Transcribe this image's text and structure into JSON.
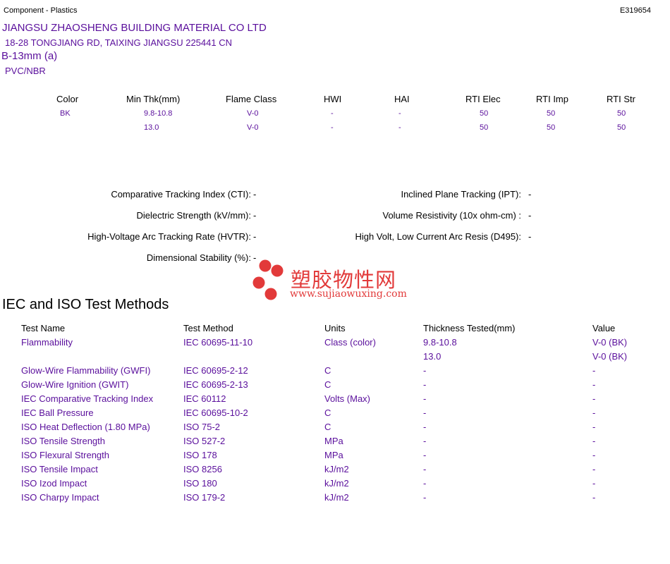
{
  "header": {
    "category": "Component - Plastics",
    "file_number": "E319654"
  },
  "company": {
    "name": "JIANGSU ZHAOSHENG BUILDING MATERIAL CO LTD",
    "address": "18-28 TONGJIANG RD, TAIXING  JIANGSU  225441 CN",
    "product": "B-13mm (a)",
    "material": "PVC/NBR"
  },
  "ratings_table": {
    "headers": [
      "Color",
      "Min Thk(mm)",
      "Flame Class",
      "HWI",
      "HAI",
      "RTI Elec",
      "RTI Imp",
      "RTI Str"
    ],
    "rows": [
      [
        "BK",
        "9.8-10.8",
        "V-0",
        "-",
        "-",
        "50",
        "50",
        "50"
      ],
      [
        "",
        "13.0",
        "V-0",
        "-",
        "-",
        "50",
        "50",
        "50"
      ]
    ]
  },
  "properties": {
    "left": [
      {
        "label": "Comparative Tracking Index (CTI):",
        "value": "-"
      },
      {
        "label": "Dielectric Strength (kV/mm):",
        "value": "-"
      },
      {
        "label": "High-Voltage Arc Tracking Rate (HVTR):",
        "value": "-"
      },
      {
        "label": "Dimensional Stability (%):",
        "value": "-"
      }
    ],
    "right": [
      {
        "label": "Inclined Plane Tracking (IPT):",
        "value": "-"
      },
      {
        "label": "Volume Resistivity (10x ohm-cm) :",
        "value": "-"
      },
      {
        "label": "High Volt, Low Current Arc Resis (D495):",
        "value": "-"
      }
    ]
  },
  "watermark": {
    "text": "塑胶物性网",
    "url": "www.sujiaowuxing.com",
    "color": "#e23a3a"
  },
  "test_methods": {
    "title": "IEC and ISO Test Methods",
    "headers": [
      "Test Name",
      "Test Method",
      "Units",
      "Thickness Tested(mm)",
      "Value"
    ],
    "rows": [
      [
        "Flammability",
        "IEC 60695-11-10",
        "Class (color)",
        "9.8-10.8",
        "V-0 (BK)"
      ],
      [
        "",
        "",
        "",
        "13.0",
        "V-0 (BK)"
      ],
      [
        "Glow-Wire Flammability (GWFI)",
        "IEC 60695-2-12",
        "C",
        "-",
        "-"
      ],
      [
        "Glow-Wire Ignition (GWIT)",
        "IEC 60695-2-13",
        "C",
        "-",
        "-"
      ],
      [
        "IEC Comparative Tracking Index",
        "IEC 60112",
        "Volts (Max)",
        "-",
        "-"
      ],
      [
        "IEC Ball Pressure",
        "IEC 60695-10-2",
        "C",
        "-",
        "-"
      ],
      [
        "ISO Heat Deflection (1.80 MPa)",
        "ISO 75-2",
        "C",
        "-",
        "-"
      ],
      [
        "ISO Tensile Strength",
        "ISO 527-2",
        "MPa",
        "-",
        "-"
      ],
      [
        "ISO Flexural Strength",
        "ISO 178",
        "MPa",
        "-",
        "-"
      ],
      [
        "ISO Tensile Impact",
        "ISO 8256",
        "kJ/m2",
        "-",
        "-"
      ],
      [
        "ISO Izod Impact",
        "ISO 180",
        "kJ/m2",
        "-",
        "-"
      ],
      [
        "ISO Charpy Impact",
        "ISO 179-2",
        "kJ/m2",
        "-",
        "-"
      ]
    ]
  }
}
